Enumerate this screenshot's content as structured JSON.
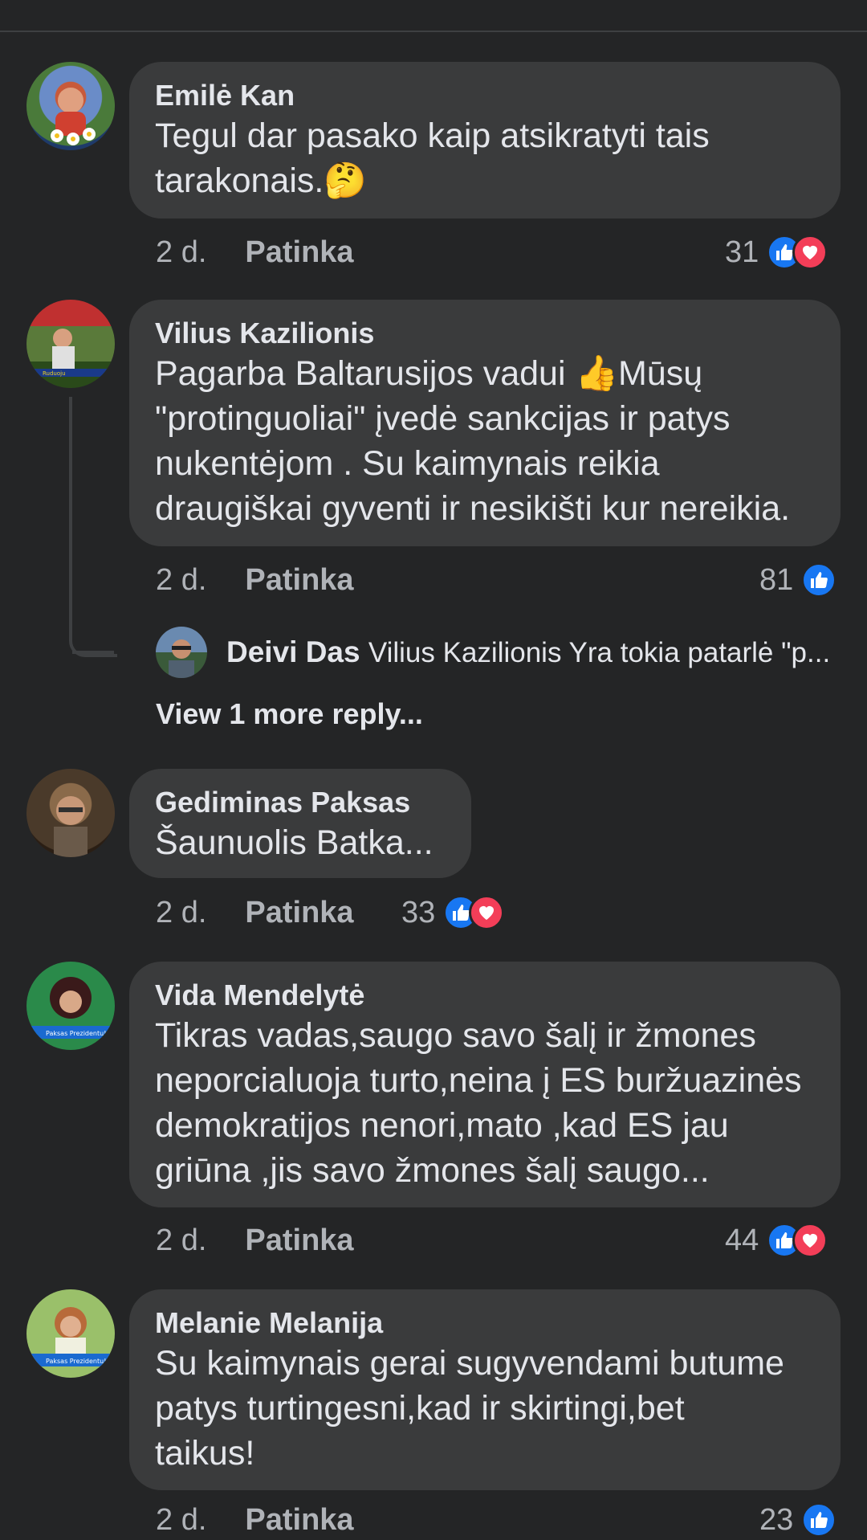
{
  "comments": [
    {
      "author": "Emilė Kan",
      "text": "Tegul dar pasako kaip atsikratyti tais\ntarakonais.🤔",
      "time": "2 d.",
      "like": "Patinka",
      "reactions": "31",
      "reaction_icons": [
        "like-icon",
        "love-icon"
      ]
    },
    {
      "author": "Vilius Kazilionis",
      "text": "Pagarba Baltarusijos vadui 👍Mūsų\n\"protinguoliai\" įvedė sankcijas ir patys\nnukentėjom . Su kaimynais reikia\ndraugiškai gyventi ir nesikišti kur nereikia.",
      "time": "2 d.",
      "like": "Patinka",
      "reactions": "81",
      "reaction_icons": [
        "like-icon"
      ]
    },
    {
      "author": "Gediminas Paksas",
      "text": "Šaunuolis Batka...",
      "time": "2 d.",
      "like": "Patinka",
      "reactions": "33",
      "reaction_icons": [
        "like-icon",
        "love-icon"
      ]
    },
    {
      "author": "Vida Mendelytė",
      "text": "Tikras vadas,saugo savo šalį ir žmones\nneporcialuoja turto,neina į ES buržuazinės\ndemokratijos nenori,mato ,kad ES jau\ngriūna ,jis savo žmones šalį saugo...",
      "time": "2 d.",
      "like": "Patinka",
      "reactions": "44",
      "reaction_icons": [
        "like-icon",
        "love-icon"
      ]
    },
    {
      "author": "Melanie Melanija",
      "text": "Su kaimynais gerai sugyvendami butume\npatys turtingesni,kad ir skirtingi,bet\ntaikus!",
      "time": "2 d.",
      "like": "Patinka",
      "reactions": "23",
      "reaction_icons": [
        "like-icon"
      ]
    }
  ],
  "reply": {
    "author": "Deivi Das",
    "text": "Vilius Kazilionis Yra tokia patarlė \"p..."
  },
  "more_replies": "View 1 more reply...",
  "colors": {
    "background": "#242526",
    "bubble": "#3a3b3c",
    "like_blue": "#1877f2",
    "love_red": "#f33e58"
  }
}
